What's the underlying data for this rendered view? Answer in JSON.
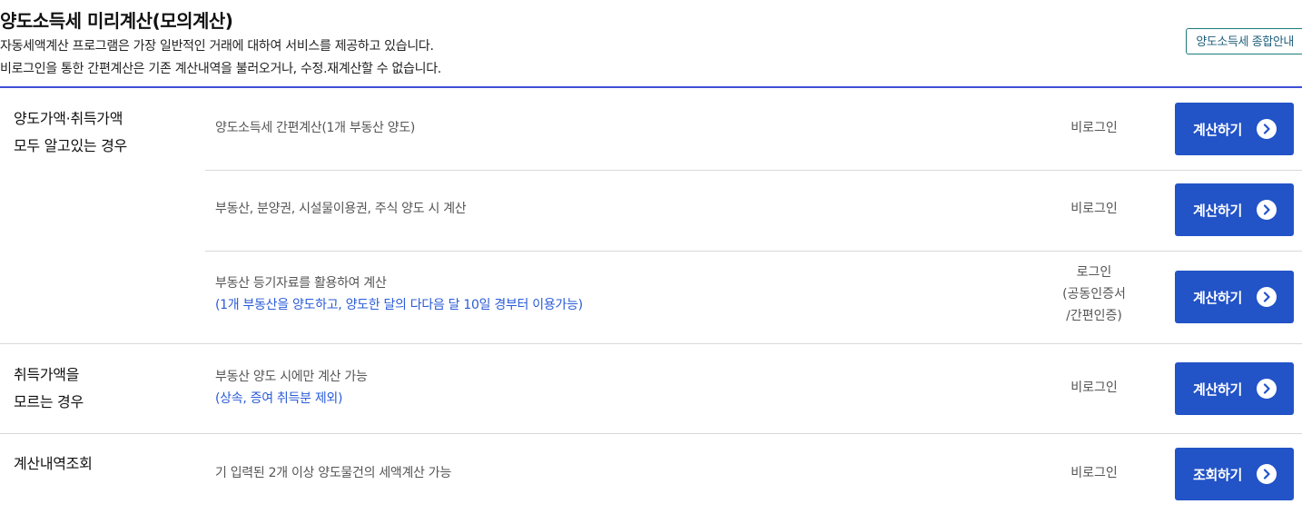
{
  "header": {
    "title": "양도소득세 미리계산(모의계산)",
    "desc1": "자동세액계산 프로그램은 가장 일반적인 거래에 대하여 서비스를 제공하고 있습니다.",
    "desc2": "비로그인을 통한 간편계산은 기존 계산내역을 불러오거나, 수정.재계산할 수 없습니다.",
    "guide_button": "양도소득세 종합안내"
  },
  "groups": [
    {
      "label_line1": "양도가액·취득가액",
      "label_line2": "모두 알고있는 경우",
      "rows": [
        {
          "desc": "양도소득세 간편계산(1개 부동산 양도)",
          "login": "비로그인",
          "button": "계산하기"
        },
        {
          "desc": "부동산, 분양권, 시설물이용권, 주식 양도 시 계산",
          "login": "비로그인",
          "button": "계산하기"
        },
        {
          "desc": "부동산 등기자료를 활용하여 계산",
          "note": "(1개 부동산을 양도하고, 양도한 달의 다다음 달 10일 경부터 이용가능)",
          "login_line1": "로그인",
          "login_line2": "(공동인증서",
          "login_line3": "/간편인증)",
          "button": "계산하기"
        }
      ]
    },
    {
      "label_line1": "취득가액을",
      "label_line2": "모르는 경우",
      "rows": [
        {
          "desc": "부동산 양도 시에만 계산 가능",
          "note": "(상속, 증여 취득분 제외)",
          "login": "비로그인",
          "button": "계산하기"
        }
      ]
    },
    {
      "label_line1": "계산내역조회",
      "rows": [
        {
          "desc": "기 입력된 2개 이상 양도물건의 세액계산 가능",
          "login": "비로그인",
          "button": "조회하기"
        }
      ]
    }
  ],
  "icons": {
    "button_arrow": "chevron-right-circle-icon"
  },
  "colors": {
    "accent": "#2253c7",
    "note": "#2a5bd7",
    "header_rule": "#3d4fd6"
  }
}
